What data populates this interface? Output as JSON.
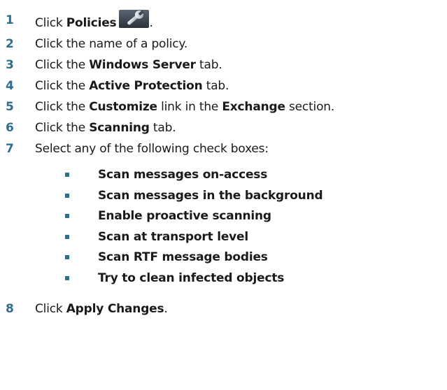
{
  "steps": [
    {
      "n": "1",
      "pre": "Click ",
      "bold": "Policies",
      "post": "."
    },
    {
      "n": "2",
      "text": "Click the name of a policy."
    },
    {
      "n": "3",
      "pre": "Click the ",
      "bold": "Windows Server",
      "post": " tab."
    },
    {
      "n": "4",
      "pre": "Click the ",
      "bold": "Active Protection",
      "post": " tab."
    },
    {
      "n": "5",
      "pre": "Click the ",
      "bold": "Customize",
      "mid": " link in the ",
      "bold2": "Exchange",
      "post": " section."
    },
    {
      "n": "6",
      "pre": "Click the ",
      "bold": "Scanning",
      "post": " tab."
    },
    {
      "n": "7",
      "text": "Select any of the following check boxes:"
    },
    {
      "n": "8",
      "pre": "Click ",
      "bold": "Apply Changes",
      "post": "."
    }
  ],
  "checkboxes": [
    "Scan messages on-access",
    "Scan messages in the background",
    "Enable proactive scanning",
    "Scan at transport level",
    "Scan RTF message bodies",
    "Try to clean infected objects"
  ],
  "icons": {
    "policies": "wrench-icon"
  },
  "colors": {
    "step_number": "#2f6e8e",
    "bullet": "#2f6e8e",
    "text": "#1a1a1a"
  }
}
